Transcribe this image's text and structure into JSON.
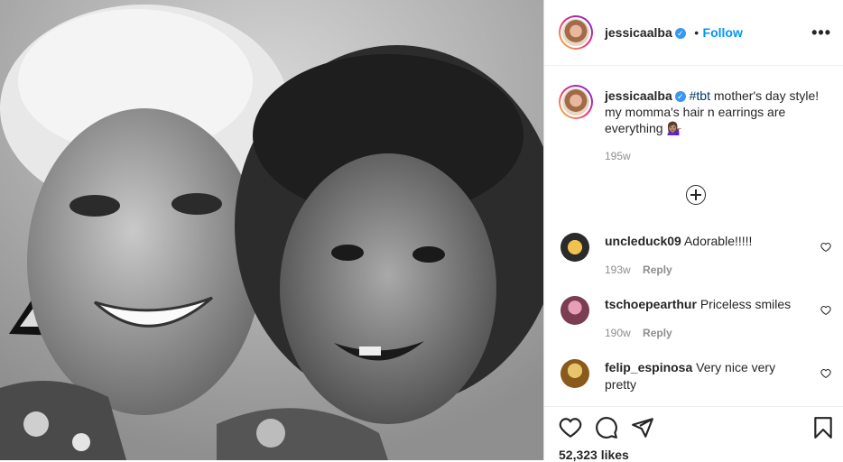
{
  "post": {
    "username": "jessicaalba",
    "follow_label": "Follow",
    "separator": "•",
    "more_label": "•••"
  },
  "caption": {
    "username": "jessicaalba",
    "hashtag": "#tbt",
    "text": " mother's day style! my momma's hair n earrings are everything 💁🏽‍♀️",
    "time": "195w"
  },
  "comments": [
    {
      "username": "uncleduck09",
      "text": "Adorable!!!!!",
      "time": "193w",
      "reply_label": "Reply"
    },
    {
      "username": "tschoepearthur",
      "text": "Priceless smiles",
      "time": "190w",
      "reply_label": "Reply"
    },
    {
      "username": "felip_espinosa",
      "text": "Very nice very pretty",
      "time": "",
      "reply_label": ""
    }
  ],
  "likes": "52,323 likes",
  "colors": {
    "follow": "#0095f6",
    "verified": "#3897f0",
    "hashtag": "#00376b"
  },
  "icons": {
    "verified": "verified-badge-icon",
    "more": "more-options-icon",
    "load_more": "plus-circle-icon",
    "like": "heart-icon",
    "comment": "comment-bubble-icon",
    "share": "paper-plane-icon",
    "save": "bookmark-icon"
  }
}
